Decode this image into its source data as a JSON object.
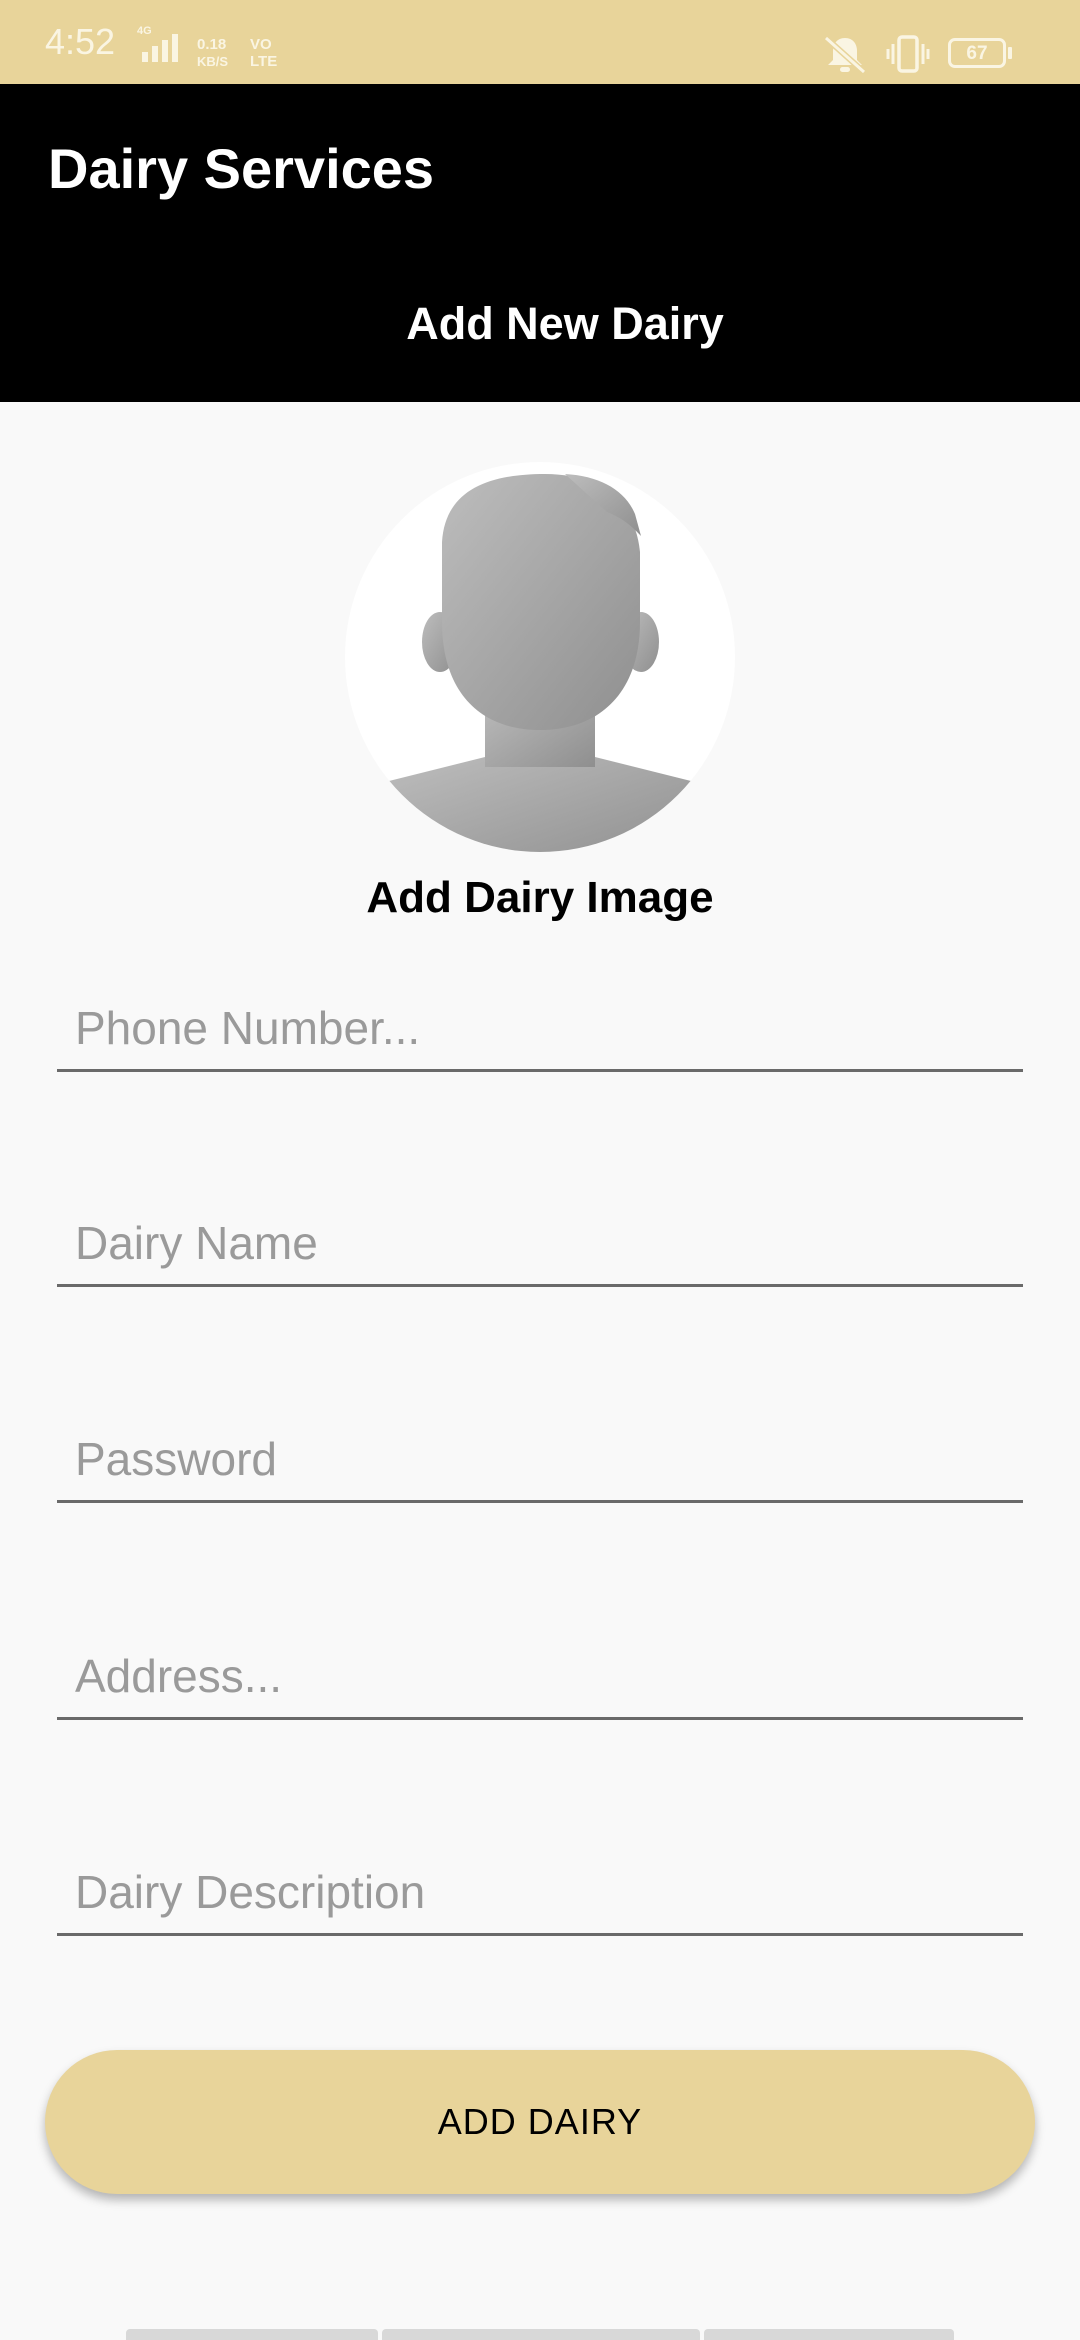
{
  "status_bar": {
    "time": "4:52",
    "network_type": "4G",
    "data_rate_value": "0.18",
    "data_rate_unit": "KB/S",
    "volte_top": "VO",
    "volte_bottom": "LTE",
    "battery": "67",
    "icons": [
      "mute-vibrate-icon",
      "vibrate-icon",
      "battery-icon"
    ]
  },
  "app_bar": {
    "title": "Dairy Services",
    "subtitle": "Add New Dairy"
  },
  "avatar": {
    "caption": "Add Dairy Image",
    "icon": "person-placeholder-icon"
  },
  "form": {
    "fields": [
      {
        "placeholder": "Phone Number...",
        "value": ""
      },
      {
        "placeholder": "Dairy Name",
        "value": ""
      },
      {
        "placeholder": "Password",
        "value": ""
      },
      {
        "placeholder": "Address...",
        "value": ""
      },
      {
        "placeholder": "Dairy Description",
        "value": ""
      }
    ],
    "submit_label": "ADD DAIRY"
  },
  "colors": {
    "accent": "#e8d49a",
    "app_bar": "#000000",
    "background": "#f9f9f9"
  }
}
